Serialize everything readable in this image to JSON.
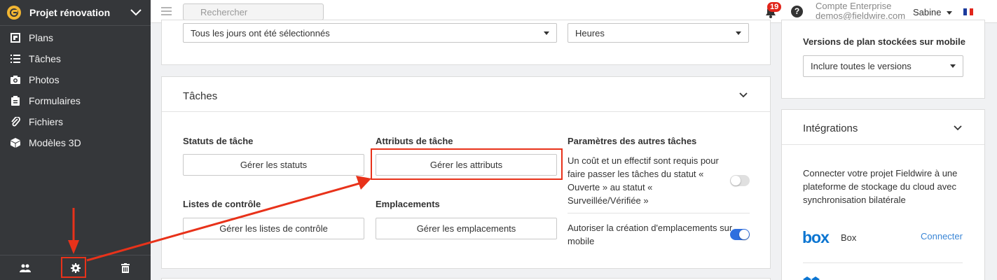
{
  "project": {
    "name": "Projet rénovation"
  },
  "nav": [
    {
      "label": "Plans",
      "icon": "plans-icon"
    },
    {
      "label": "Tâches",
      "icon": "list-icon"
    },
    {
      "label": "Photos",
      "icon": "camera-icon"
    },
    {
      "label": "Formulaires",
      "icon": "clipboard-icon"
    },
    {
      "label": "Fichiers",
      "icon": "paperclip-icon"
    },
    {
      "label": "Modèles 3D",
      "icon": "cube-icon"
    }
  ],
  "topbar": {
    "search_placeholder": "Rechercher",
    "notifications_count": "19",
    "account_type": "Compte Enterprise",
    "account_email": "demos@fieldwire.com",
    "user_name": "Sabine"
  },
  "schedule": {
    "days_select": "Tous les jours ont été sélectionnés",
    "unit_select": "Heures"
  },
  "tasks_card": {
    "title": "Tâches",
    "statuses_label": "Statuts de tâche",
    "statuses_button": "Gérer les statuts",
    "attributes_label": "Attributs de tâche",
    "attributes_button": "Gérer les attributs",
    "checklists_label": "Listes de contrôle",
    "checklists_button": "Gérer les listes de contrôle",
    "locations_label": "Emplacements",
    "locations_button": "Gérer les emplacements",
    "other_label": "Paramètres des autres tâches",
    "setting1": "Un coût et un effectif sont requis pour faire passer les tâches du statut « Ouverte » au statut « Surveillée/Vérifiée »",
    "setting1_on": false,
    "setting2": "Autoriser la création d'emplacements sur mobile",
    "setting2_on": true
  },
  "mobile_card": {
    "title": "Versions de plan stockées sur mobile",
    "select": "Inclure toutes le versions"
  },
  "integrations": {
    "title": "Intégrations",
    "description": "Connecter votre projet Fieldwire à une plateforme de stockage du cloud avec synchronisation bilatérale",
    "logo_text": "box",
    "name": "Box",
    "connect": "Connecter"
  },
  "colors": {
    "sidebar": "#35373a",
    "highlight": "#e8321a",
    "toggle_on": "#2f6fdf",
    "link": "#3a86d6",
    "box_blue": "#0b75d1"
  }
}
